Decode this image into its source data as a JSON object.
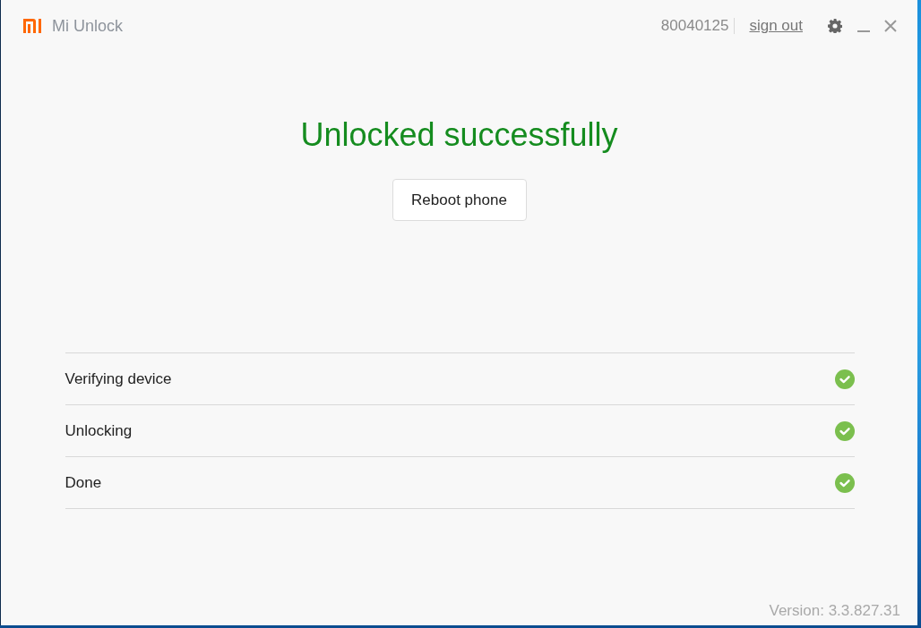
{
  "window": {
    "title": "Mi Unlock"
  },
  "account": {
    "id": "80040125",
    "sign_out": "sign out"
  },
  "status": {
    "heading": "Unlocked successfully",
    "button": "Reboot phone"
  },
  "steps": [
    {
      "label": "Verifying device",
      "done": true
    },
    {
      "label": "Unlocking",
      "done": true
    },
    {
      "label": "Done",
      "done": true
    }
  ],
  "footer": {
    "version": "Version: 3.3.827.31"
  }
}
